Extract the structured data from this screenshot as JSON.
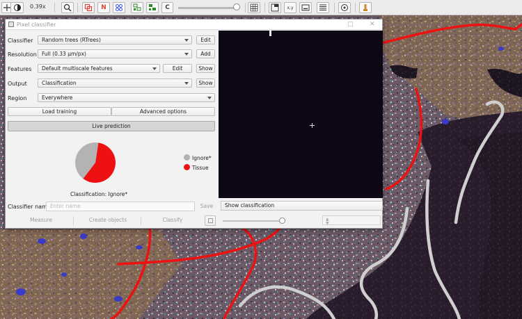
{
  "toolbar": {
    "zoom": "0.39x",
    "buttons": [
      {
        "name": "move-tool-icon"
      },
      {
        "name": "brightness-contrast-icon"
      },
      {
        "name": "zoom-icon"
      },
      {
        "name": "show-annotations-icon"
      },
      {
        "name": "show-names-icon",
        "text": "N"
      },
      {
        "name": "show-tma-grid-icon"
      },
      {
        "name": "show-detections-icon"
      },
      {
        "name": "fill-detections-icon"
      },
      {
        "name": "show-classification-overlay-icon",
        "text": "C"
      },
      {
        "name": "show-grid-icon"
      },
      {
        "name": "show-overview-icon"
      },
      {
        "name": "show-cursor-location-icon",
        "text": "x,y"
      },
      {
        "name": "show-scalebar-icon"
      },
      {
        "name": "show-command-list-icon"
      },
      {
        "name": "record-icon"
      },
      {
        "name": "log-viewer-icon"
      }
    ],
    "accent_color": "#e0443a"
  },
  "dialog": {
    "title": "Pixel classifier",
    "classifier": {
      "label": "Classifier",
      "value": "Random trees (RTrees)",
      "button": "Edit"
    },
    "resolution": {
      "label": "Resolution",
      "value": "Full (0.33 µm/px)",
      "button": "Add"
    },
    "features": {
      "label": "Features",
      "value": "Default multiscale features",
      "button1": "Edit",
      "button2": "Show"
    },
    "output": {
      "label": "Output",
      "value": "Classification",
      "button": "Show"
    },
    "region": {
      "label": "Region",
      "value": "Everywhere"
    },
    "load_training": "Load training",
    "advanced_options": "Advanced options",
    "live_prediction": "Live prediction",
    "pie": {
      "slices": [
        {
          "name": "Tissue",
          "value": 0.58,
          "color": "#ee1111"
        },
        {
          "name": "Ignore*",
          "value": 0.42,
          "color": "#b3b3b3"
        }
      ],
      "caption": "Classification: Ignore*"
    },
    "legend": [
      {
        "label": "Ignore*",
        "color": "#b3b3b3"
      },
      {
        "label": "Tissue",
        "color": "#ee1111"
      }
    ],
    "classifier_name_label": "Classifier name",
    "classifier_name_placeholder": "Enter name",
    "save": "Save",
    "measure": "Measure",
    "create_objects": "Create objects",
    "classify": "Classify",
    "show_classification": "Show classification"
  }
}
